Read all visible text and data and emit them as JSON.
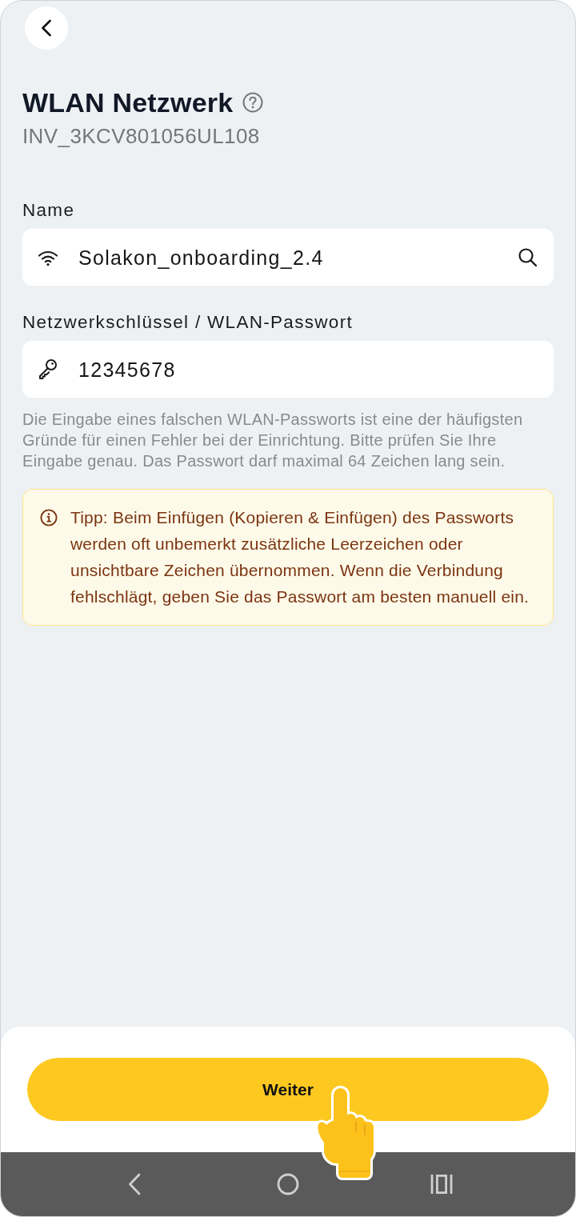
{
  "title": "WLAN Netzwerk",
  "subtitle": "INV_3KCV801056UL108",
  "fields": [
    {
      "kind": "network",
      "label": "Name",
      "value": "Solakon_onboarding_2.4"
    },
    {
      "kind": "password",
      "label": "Netzwerkschlüssel / WLAN-Passwort",
      "value": "12345678"
    }
  ],
  "hint": "Die Eingabe eines falschen WLAN-Passworts ist eine der häufigsten Gründe für einen Fehler bei der Einrichtung. Bitte prüfen Sie Ihre Eingabe genau. Das Passwort darf maximal 64 Zeichen lang sein.",
  "tip": "Tipp: Beim Einfügen (Kopieren & Einfügen) des Passworts werden oft unbemerkt zusätzliche Leerzeichen oder unsichtbare Zeichen übernommen. Wenn die Verbindung fehlschlägt, geben Sie das Passwort am besten manuell ein.",
  "primary_button": "Weiter"
}
